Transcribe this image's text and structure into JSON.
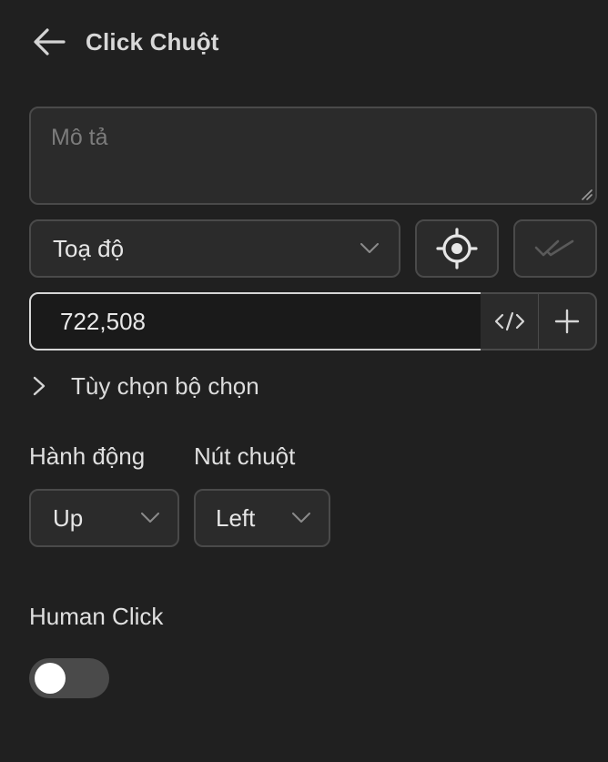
{
  "header": {
    "title": "Click Chuột",
    "back_icon": "arrow-left-icon"
  },
  "description": {
    "placeholder": "Mô tả",
    "value": ""
  },
  "locator": {
    "selected": "Toạ độ",
    "target_icon": "crosshair-icon",
    "verify_icon": "double-check-icon"
  },
  "coordinates": {
    "value": "722,508",
    "code_icon": "code-icon",
    "add_icon": "plus-icon"
  },
  "selector_options": {
    "label": "Tùy chọn bộ chọn",
    "icon": "chevron-right-icon"
  },
  "action": {
    "label": "Hành động",
    "selected": "Up"
  },
  "mouse_button": {
    "label": "Nút chuột",
    "selected": "Left"
  },
  "human_click": {
    "label": "Human Click",
    "enabled": false
  },
  "colors": {
    "background": "#202020",
    "field": "#2b2b2b",
    "border": "#4a4a4a",
    "focus_border": "#d6d6d6"
  }
}
